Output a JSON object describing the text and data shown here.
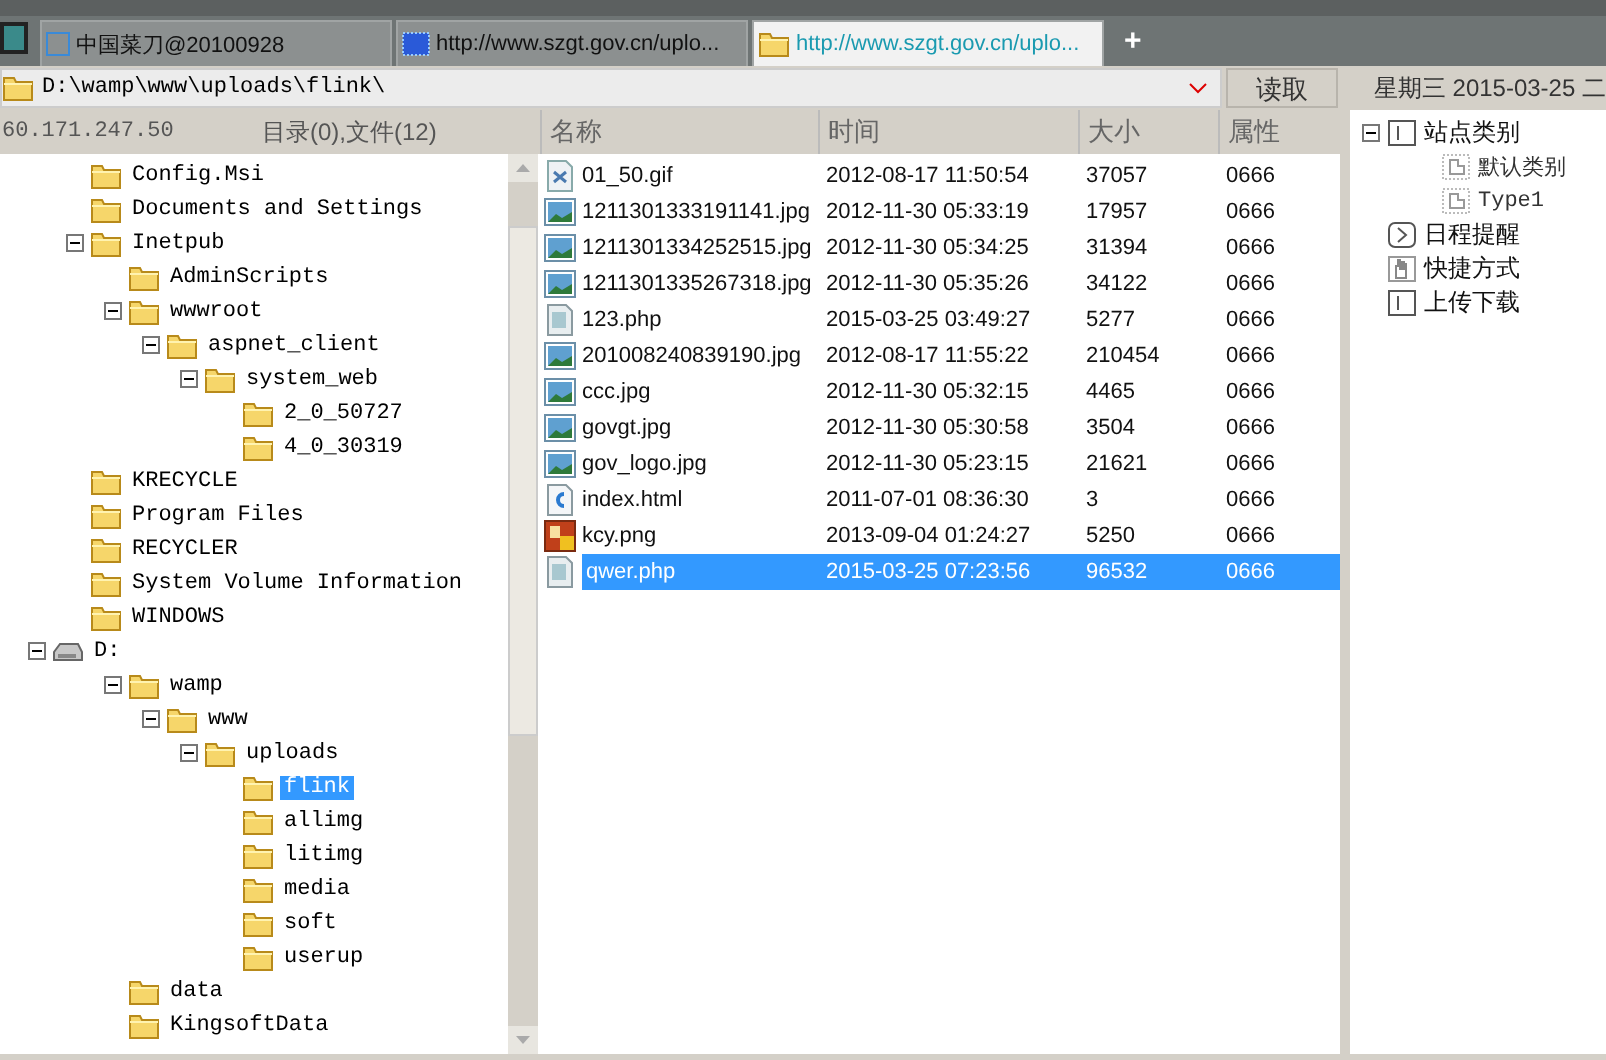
{
  "tabs": [
    {
      "label": "中国菜刀@20100928",
      "kind": "list",
      "selected": false
    },
    {
      "label": "http://www.szgt.gov.cn/uplo...",
      "kind": "web",
      "selected": false
    },
    {
      "label": "http://www.szgt.gov.cn/uplo...",
      "kind": "folder",
      "selected": true
    }
  ],
  "new_tab": "+",
  "address": {
    "value": "D:\\wamp\\www\\uploads\\flink\\",
    "read_button": "读取",
    "date": "星期三 2015-03-25 二"
  },
  "host": "60.171.247.50",
  "summary": "目录(0),文件(12)",
  "tree": [
    {
      "label": "Config.Msi",
      "kind": "folder",
      "selected": false
    },
    {
      "label": "Documents and Settings",
      "kind": "folder",
      "selected": false
    },
    {
      "label": "Inetpub",
      "kind": "folder",
      "expanded": true,
      "selected": false,
      "children": [
        {
          "label": "AdminScripts",
          "kind": "folder",
          "selected": false
        },
        {
          "label": "wwwroot",
          "kind": "folder",
          "expanded": true,
          "selected": false,
          "children": [
            {
              "label": "aspnet_client",
              "kind": "folder",
              "expanded": true,
              "selected": false,
              "children": [
                {
                  "label": "system_web",
                  "kind": "folder",
                  "expanded": true,
                  "selected": false,
                  "children": [
                    {
                      "label": "2_0_50727",
                      "kind": "folder",
                      "selected": false
                    },
                    {
                      "label": "4_0_30319",
                      "kind": "folder",
                      "selected": false
                    }
                  ]
                }
              ]
            }
          ]
        }
      ]
    },
    {
      "label": "KRECYCLE",
      "kind": "folder",
      "selected": false
    },
    {
      "label": "Program Files",
      "kind": "folder",
      "selected": false
    },
    {
      "label": "RECYCLER",
      "kind": "folder",
      "selected": false
    },
    {
      "label": "System Volume Information",
      "kind": "folder",
      "selected": false
    },
    {
      "label": "WINDOWS",
      "kind": "folder",
      "selected": false
    },
    {
      "label": "D:",
      "kind": "drive",
      "expanded": true,
      "selected": false,
      "children": [
        {
          "label": "wamp",
          "kind": "folder",
          "expanded": true,
          "selected": false,
          "children": [
            {
              "label": "www",
              "kind": "folder",
              "expanded": true,
              "selected": false,
              "children": [
                {
                  "label": "uploads",
                  "kind": "folder",
                  "expanded": true,
                  "selected": false,
                  "children": [
                    {
                      "label": "flink",
                      "kind": "folder",
                      "selected": true
                    },
                    {
                      "label": "allimg",
                      "kind": "folder",
                      "selected": false
                    },
                    {
                      "label": "litimg",
                      "kind": "folder",
                      "selected": false
                    },
                    {
                      "label": "media",
                      "kind": "folder",
                      "selected": false
                    },
                    {
                      "label": "soft",
                      "kind": "folder",
                      "selected": false
                    },
                    {
                      "label": "userup",
                      "kind": "folder",
                      "selected": false
                    }
                  ]
                }
              ]
            }
          ]
        },
        {
          "label": "data",
          "kind": "folder",
          "selected": false
        },
        {
          "label": "KingsoftData",
          "kind": "folder",
          "selected": false
        }
      ]
    }
  ],
  "file_columns": [
    "名称",
    "时间",
    "大小",
    "属性"
  ],
  "files": [
    {
      "name": "01_50.gif",
      "time": "2012-08-17 11:50:54",
      "size": "37057",
      "attr": "0666",
      "kind": "gif",
      "selected": false
    },
    {
      "name": "1211301333191141.jpg",
      "time": "2012-11-30 05:33:19",
      "size": "17957",
      "attr": "0666",
      "kind": "image",
      "selected": false
    },
    {
      "name": "1211301334252515.jpg",
      "time": "2012-11-30 05:34:25",
      "size": "31394",
      "attr": "0666",
      "kind": "image",
      "selected": false
    },
    {
      "name": "1211301335267318.jpg",
      "time": "2012-11-30 05:35:26",
      "size": "34122",
      "attr": "0666",
      "kind": "image",
      "selected": false
    },
    {
      "name": "123.php",
      "time": "2015-03-25 03:49:27",
      "size": "5277",
      "attr": "0666",
      "kind": "doc",
      "selected": false
    },
    {
      "name": "201008240839190.jpg",
      "time": "2012-08-17 11:55:22",
      "size": "210454",
      "attr": "0666",
      "kind": "image",
      "selected": false
    },
    {
      "name": "ccc.jpg",
      "time": "2012-11-30 05:32:15",
      "size": "4465",
      "attr": "0666",
      "kind": "image",
      "selected": false
    },
    {
      "name": "govgt.jpg",
      "time": "2012-11-30 05:30:58",
      "size": "3504",
      "attr": "0666",
      "kind": "image",
      "selected": false
    },
    {
      "name": "gov_logo.jpg",
      "time": "2012-11-30 05:23:15",
      "size": "21621",
      "attr": "0666",
      "kind": "image",
      "selected": false
    },
    {
      "name": "index.html",
      "time": "2011-07-01 08:36:30",
      "size": "3",
      "attr": "0666",
      "kind": "html",
      "selected": false
    },
    {
      "name": "kcy.png",
      "time": "2013-09-04 01:24:27",
      "size": "5250",
      "attr": "0666",
      "kind": "png",
      "selected": false
    },
    {
      "name": "qwer.php",
      "time": "2015-03-25 07:23:56",
      "size": "96532",
      "attr": "0666",
      "kind": "doc",
      "selected": true
    }
  ],
  "side_tree": [
    {
      "label": "站点类别",
      "kind": "category",
      "expanded": true,
      "children": [
        {
          "label": "默认类别",
          "kind": "page"
        },
        {
          "label": "Type1",
          "kind": "page"
        }
      ]
    },
    {
      "label": "日程提醒",
      "kind": "schedule"
    },
    {
      "label": "快捷方式",
      "kind": "shortcut"
    },
    {
      "label": "上传下载",
      "kind": "category"
    }
  ]
}
